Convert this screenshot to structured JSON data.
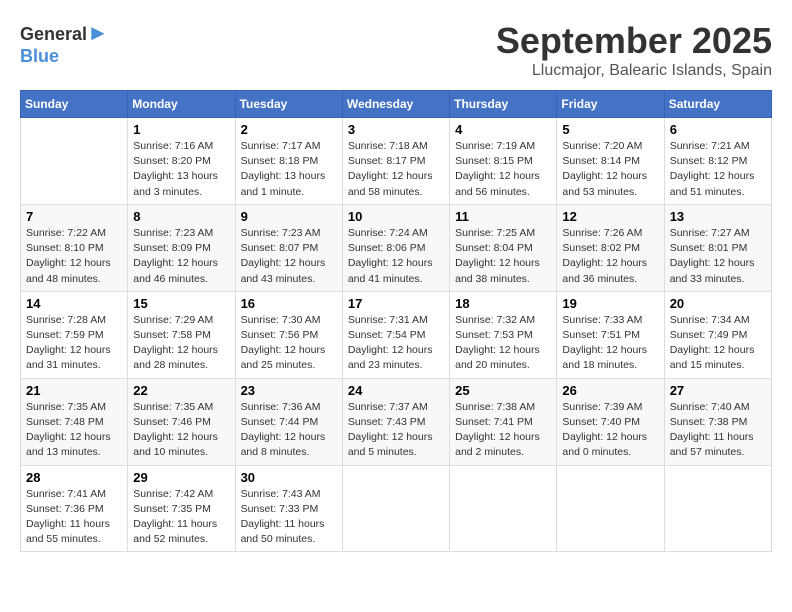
{
  "header": {
    "logo": {
      "general": "General",
      "blue": "Blue"
    },
    "title": "September 2025",
    "location": "Llucmajor, Balearic Islands, Spain"
  },
  "calendar": {
    "days_of_week": [
      "Sunday",
      "Monday",
      "Tuesday",
      "Wednesday",
      "Thursday",
      "Friday",
      "Saturday"
    ],
    "weeks": [
      [
        {
          "day": "",
          "info": ""
        },
        {
          "day": "1",
          "info": "Sunrise: 7:16 AM\nSunset: 8:20 PM\nDaylight: 13 hours\nand 3 minutes."
        },
        {
          "day": "2",
          "info": "Sunrise: 7:17 AM\nSunset: 8:18 PM\nDaylight: 13 hours\nand 1 minute."
        },
        {
          "day": "3",
          "info": "Sunrise: 7:18 AM\nSunset: 8:17 PM\nDaylight: 12 hours\nand 58 minutes."
        },
        {
          "day": "4",
          "info": "Sunrise: 7:19 AM\nSunset: 8:15 PM\nDaylight: 12 hours\nand 56 minutes."
        },
        {
          "day": "5",
          "info": "Sunrise: 7:20 AM\nSunset: 8:14 PM\nDaylight: 12 hours\nand 53 minutes."
        },
        {
          "day": "6",
          "info": "Sunrise: 7:21 AM\nSunset: 8:12 PM\nDaylight: 12 hours\nand 51 minutes."
        }
      ],
      [
        {
          "day": "7",
          "info": "Sunrise: 7:22 AM\nSunset: 8:10 PM\nDaylight: 12 hours\nand 48 minutes."
        },
        {
          "day": "8",
          "info": "Sunrise: 7:23 AM\nSunset: 8:09 PM\nDaylight: 12 hours\nand 46 minutes."
        },
        {
          "day": "9",
          "info": "Sunrise: 7:23 AM\nSunset: 8:07 PM\nDaylight: 12 hours\nand 43 minutes."
        },
        {
          "day": "10",
          "info": "Sunrise: 7:24 AM\nSunset: 8:06 PM\nDaylight: 12 hours\nand 41 minutes."
        },
        {
          "day": "11",
          "info": "Sunrise: 7:25 AM\nSunset: 8:04 PM\nDaylight: 12 hours\nand 38 minutes."
        },
        {
          "day": "12",
          "info": "Sunrise: 7:26 AM\nSunset: 8:02 PM\nDaylight: 12 hours\nand 36 minutes."
        },
        {
          "day": "13",
          "info": "Sunrise: 7:27 AM\nSunset: 8:01 PM\nDaylight: 12 hours\nand 33 minutes."
        }
      ],
      [
        {
          "day": "14",
          "info": "Sunrise: 7:28 AM\nSunset: 7:59 PM\nDaylight: 12 hours\nand 31 minutes."
        },
        {
          "day": "15",
          "info": "Sunrise: 7:29 AM\nSunset: 7:58 PM\nDaylight: 12 hours\nand 28 minutes."
        },
        {
          "day": "16",
          "info": "Sunrise: 7:30 AM\nSunset: 7:56 PM\nDaylight: 12 hours\nand 25 minutes."
        },
        {
          "day": "17",
          "info": "Sunrise: 7:31 AM\nSunset: 7:54 PM\nDaylight: 12 hours\nand 23 minutes."
        },
        {
          "day": "18",
          "info": "Sunrise: 7:32 AM\nSunset: 7:53 PM\nDaylight: 12 hours\nand 20 minutes."
        },
        {
          "day": "19",
          "info": "Sunrise: 7:33 AM\nSunset: 7:51 PM\nDaylight: 12 hours\nand 18 minutes."
        },
        {
          "day": "20",
          "info": "Sunrise: 7:34 AM\nSunset: 7:49 PM\nDaylight: 12 hours\nand 15 minutes."
        }
      ],
      [
        {
          "day": "21",
          "info": "Sunrise: 7:35 AM\nSunset: 7:48 PM\nDaylight: 12 hours\nand 13 minutes."
        },
        {
          "day": "22",
          "info": "Sunrise: 7:35 AM\nSunset: 7:46 PM\nDaylight: 12 hours\nand 10 minutes."
        },
        {
          "day": "23",
          "info": "Sunrise: 7:36 AM\nSunset: 7:44 PM\nDaylight: 12 hours\nand 8 minutes."
        },
        {
          "day": "24",
          "info": "Sunrise: 7:37 AM\nSunset: 7:43 PM\nDaylight: 12 hours\nand 5 minutes."
        },
        {
          "day": "25",
          "info": "Sunrise: 7:38 AM\nSunset: 7:41 PM\nDaylight: 12 hours\nand 2 minutes."
        },
        {
          "day": "26",
          "info": "Sunrise: 7:39 AM\nSunset: 7:40 PM\nDaylight: 12 hours\nand 0 minutes."
        },
        {
          "day": "27",
          "info": "Sunrise: 7:40 AM\nSunset: 7:38 PM\nDaylight: 11 hours\nand 57 minutes."
        }
      ],
      [
        {
          "day": "28",
          "info": "Sunrise: 7:41 AM\nSunset: 7:36 PM\nDaylight: 11 hours\nand 55 minutes."
        },
        {
          "day": "29",
          "info": "Sunrise: 7:42 AM\nSunset: 7:35 PM\nDaylight: 11 hours\nand 52 minutes."
        },
        {
          "day": "30",
          "info": "Sunrise: 7:43 AM\nSunset: 7:33 PM\nDaylight: 11 hours\nand 50 minutes."
        },
        {
          "day": "",
          "info": ""
        },
        {
          "day": "",
          "info": ""
        },
        {
          "day": "",
          "info": ""
        },
        {
          "day": "",
          "info": ""
        }
      ]
    ]
  }
}
